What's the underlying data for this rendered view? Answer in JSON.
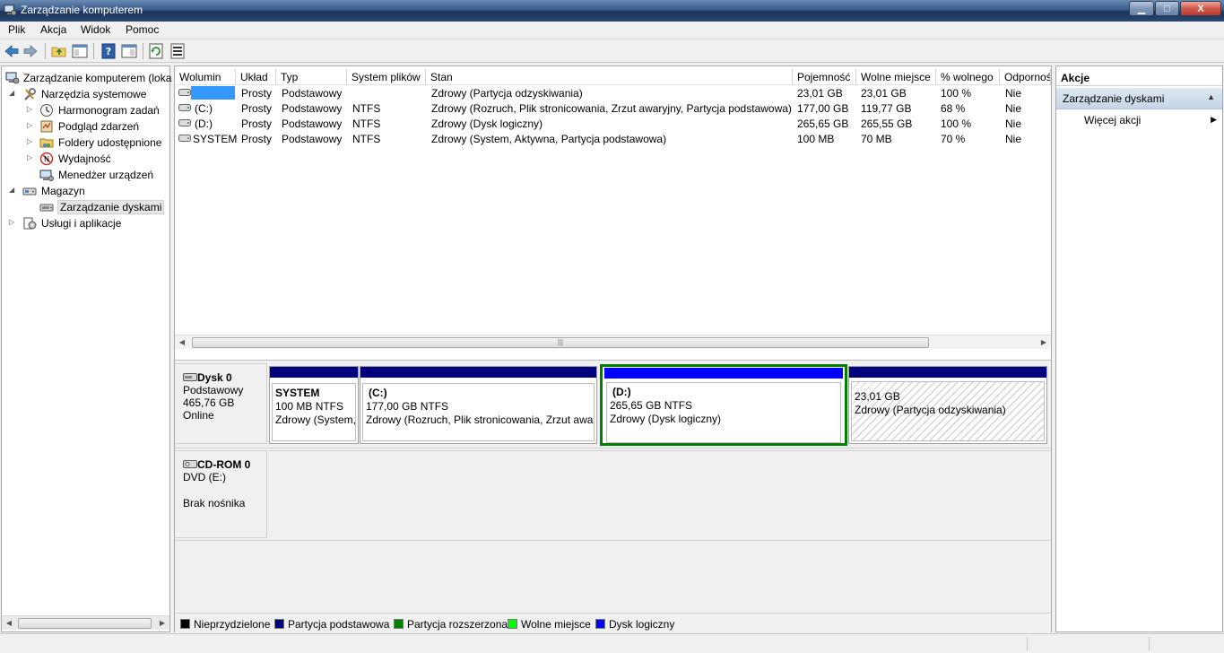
{
  "window": {
    "title": "Zarządzanie komputerem",
    "min_label": "▁",
    "max_label": "□",
    "close_label": "X"
  },
  "menu": [
    {
      "label": "Plik"
    },
    {
      "label": "Akcja"
    },
    {
      "label": "Widok"
    },
    {
      "label": "Pomoc"
    }
  ],
  "toolbar": {
    "icons": [
      "back-icon",
      "forward-icon",
      "up-folder-icon",
      "console-tree-icon",
      "help-icon",
      "properties-icon",
      "refresh-icon",
      "export-icon"
    ]
  },
  "tree": {
    "root": "Zarządzanie komputerem (loka",
    "items": [
      {
        "label": "Narzędzia systemowe",
        "expand": "◢"
      },
      {
        "label": "Harmonogram zadań",
        "expand": "▷"
      },
      {
        "label": "Podgląd zdarzeń",
        "expand": "▷"
      },
      {
        "label": "Foldery udostępnione",
        "expand": "▷"
      },
      {
        "label": "Wydajność",
        "expand": "▷"
      },
      {
        "label": "Menedżer urządzeń",
        "expand": ""
      },
      {
        "label": "Magazyn",
        "expand": "◢"
      },
      {
        "label": "Zarządzanie dyskami",
        "expand": ""
      },
      {
        "label": "Usługi i aplikacje",
        "expand": "▷"
      }
    ]
  },
  "volumes": {
    "columns": [
      "Wolumin",
      "Układ",
      "Typ",
      "System plików",
      "Stan",
      "Pojemność",
      "Wolne miejsce",
      "% wolnego",
      "Odpornoś"
    ],
    "rows": [
      {
        "name": "",
        "layout": "Prosty",
        "type": "Podstawowy",
        "fs": "",
        "status": "Zdrowy (Partycja odzyskiwania)",
        "capacity": "23,01 GB",
        "free": "23,01 GB",
        "pct": "100 %",
        "ft": "Nie"
      },
      {
        "name": "(C:)",
        "layout": "Prosty",
        "type": "Podstawowy",
        "fs": "NTFS",
        "status": "Zdrowy (Rozruch, Plik stronicowania, Zrzut awaryjny, Partycja podstawowa)",
        "capacity": "177,00 GB",
        "free": "119,77 GB",
        "pct": "68 %",
        "ft": "Nie"
      },
      {
        "name": "(D:)",
        "layout": "Prosty",
        "type": "Podstawowy",
        "fs": "NTFS",
        "status": "Zdrowy (Dysk logiczny)",
        "capacity": "265,65 GB",
        "free": "265,55 GB",
        "pct": "100 %",
        "ft": "Nie"
      },
      {
        "name": "SYSTEM",
        "layout": "Prosty",
        "type": "Podstawowy",
        "fs": "NTFS",
        "status": "Zdrowy (System, Aktywna, Partycja podstawowa)",
        "capacity": "100 MB",
        "free": "70 MB",
        "pct": "70 %",
        "ft": "Nie"
      }
    ]
  },
  "disks": [
    {
      "name": "Dysk 0",
      "type": "Podstawowy",
      "size": "465,76 GB",
      "state": "Online",
      "partitions": [
        {
          "title": "SYSTEM",
          "line2": "100 MB NTFS",
          "line3": "Zdrowy (System, Aktywna, Partycja podstawowa)"
        },
        {
          "title": "(C:)",
          "line2": "177,00 GB NTFS",
          "line3": "Zdrowy (Rozruch, Plik stronicowania, Zrzut awaryjny, Partycja podstawowa)"
        },
        {
          "title": "(D:)",
          "line2": "265,65 GB NTFS",
          "line3": "Zdrowy (Dysk logiczny)"
        },
        {
          "title": "",
          "line2": "23,01 GB",
          "line3": "Zdrowy (Partycja odzyskiwania)"
        }
      ]
    },
    {
      "name": "CD-ROM 0",
      "type": "DVD (E:)",
      "size": "",
      "state": "Brak nośnika"
    }
  ],
  "legend": [
    {
      "label": "Nieprzydzielone",
      "color": "#000000"
    },
    {
      "label": "Partycja podstawowa",
      "color": "#00007f"
    },
    {
      "label": "Partycja rozszerzona",
      "color": "#007f00"
    },
    {
      "label": "Wolne miejsce",
      "color": "#00ff00"
    },
    {
      "label": "Dysk logiczny",
      "color": "#0000ff"
    }
  ],
  "actions": {
    "header": "Akcje",
    "section": "Zarządzanie dyskami",
    "more": "Więcej akcji"
  },
  "colors": {
    "primary_partition": "#00007f",
    "logical_drive": "#0000ff",
    "extended_partition": "#007f00",
    "selected_vol": "#3399ff"
  }
}
